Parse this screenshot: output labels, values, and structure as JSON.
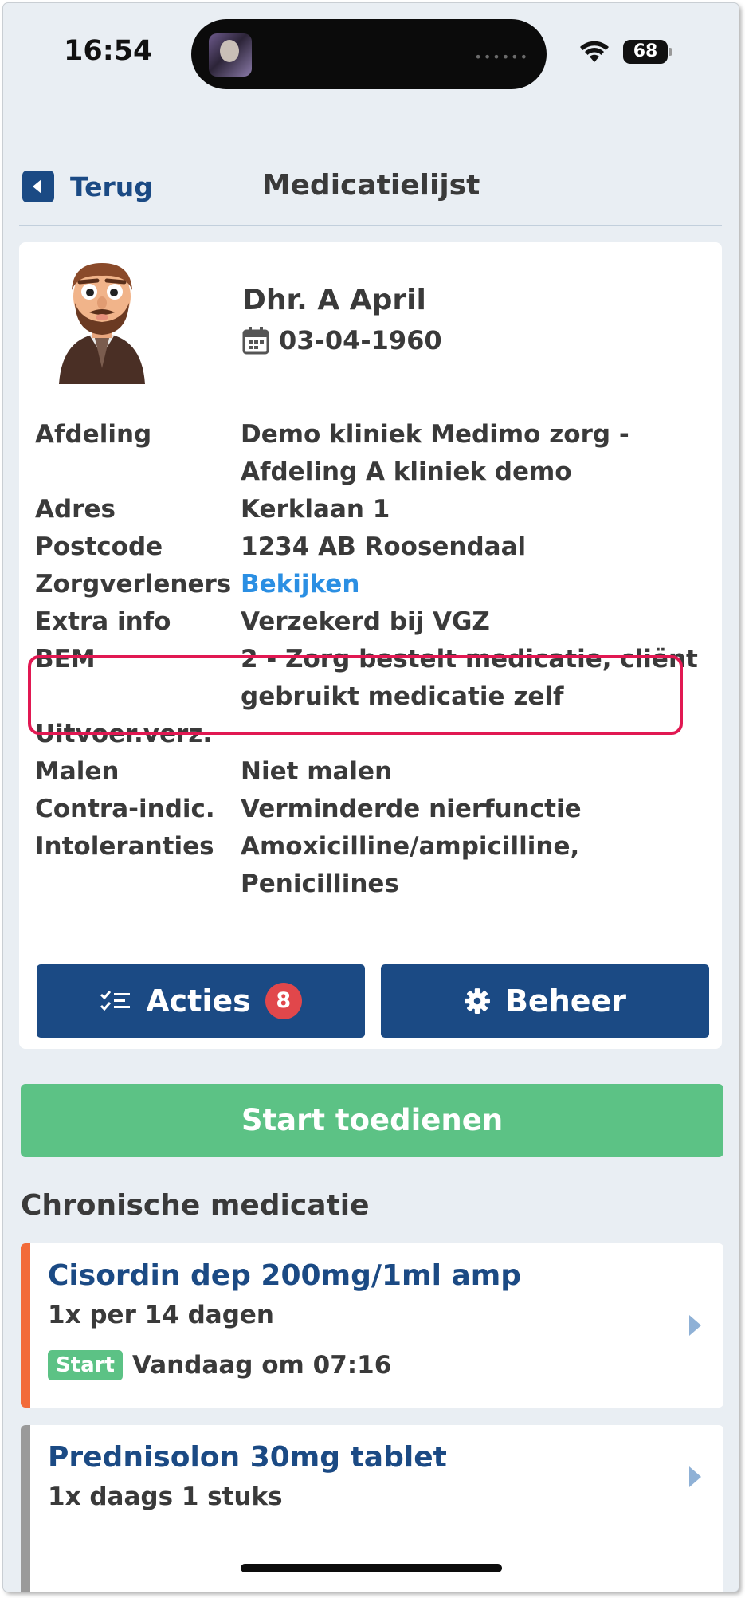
{
  "status_bar": {
    "time": "16:54",
    "battery": "68"
  },
  "nav": {
    "back_label": "Terug",
    "title": "Medicatielijst"
  },
  "patient": {
    "name": "Dhr. A April",
    "dob": "03-04-1960",
    "rows": [
      {
        "label": "Afdeling",
        "value": "Demo kliniek Medimo zorg -",
        "value2": "Afdeling A kliniek demo"
      },
      {
        "label": "Adres",
        "value": "Kerklaan 1"
      },
      {
        "label": "Postcode",
        "value": "1234 AB Roosendaal"
      },
      {
        "label": "Zorgverleners",
        "value": "Bekijken"
      },
      {
        "label": "Extra info",
        "value": "Verzekerd bij VGZ"
      },
      {
        "label": "BEM",
        "value": "2 - Zorg bestelt medicatie, cliënt",
        "value2": "gebruikt medicatie zelf"
      },
      {
        "label": "Uitvoer.verz.",
        "value": ""
      },
      {
        "label": "Malen",
        "value": "Niet malen"
      },
      {
        "label": "Contra-indic.",
        "value": "Verminderde nierfunctie"
      },
      {
        "label": "Intoleranties",
        "value": "Amoxicilline/ampicilline,",
        "value2": "Penicillines"
      }
    ]
  },
  "actions": {
    "acties_label": "Acties",
    "acties_count": "8",
    "beheer_label": "Beheer"
  },
  "start_button": "Start toedienen",
  "section_title": "Chronische medicatie",
  "medications": [
    {
      "name": "Cisordin dep 200mg/1ml amp",
      "frequency": "1x per 14 dagen",
      "tag": "Start",
      "schedule": "Vandaag om 07:16",
      "bar_color": "#f26b3a"
    },
    {
      "name": "Prednisolon 30mg tablet",
      "frequency": "1x daags 1 stuks",
      "bar_color": "#9a9a9a"
    }
  ],
  "colors": {
    "primary": "#1b4a84",
    "success": "#5cc285",
    "highlight": "#e11852",
    "link": "#2b8fe3"
  }
}
